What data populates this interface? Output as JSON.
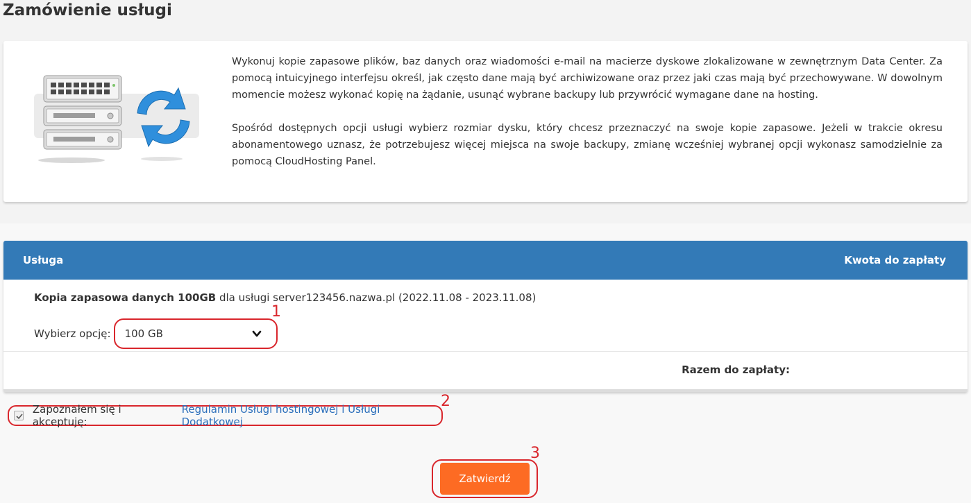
{
  "page": {
    "title": "Zamówienie usługi"
  },
  "intro": {
    "paragraph1": "Wykonuj kopie zapasowe plików, baz danych oraz wiadomości e-mail na macierze dyskowe zlokalizowane w zewnętrznym Data Center. Za pomocą intuicyjnego interfejsu określ, jak często dane mają być archiwizowane oraz przez jaki czas mają być przechowywane. W dowolnym momencie możesz wykonać kopię na żądanie, usunąć wybrane backupy lub przywrócić wymagane dane na hosting.",
    "paragraph2": "Spośród dostępnych opcji usługi wybierz rozmiar dysku, który chcesz przeznaczyć na swoje kopie zapasowe. Jeżeli w trakcie okresu abonamentowego uznasz, że potrzebujesz więcej miejsca na swoje backupy, zmianę wcześniej wybranej opcji wykonasz samodzielnie za pomocą CloudHosting Panel.",
    "illustration_icon": "server-backup-sync-icon"
  },
  "order": {
    "header_service": "Usługa",
    "header_amount": "Kwota do zapłaty",
    "service_name": "Kopia zapasowa danych 100GB",
    "service_suffix": "dla usługi server123456.nazwa.pl (2022.11.08 - 2023.11.08)",
    "option_label": "Wybierz opcję:",
    "option_selected": "100 GB",
    "total_label": "Razem do zapłaty:"
  },
  "terms": {
    "label": "Zapoznałem się i akceptuję:",
    "link_text": "Regulamin Usługi hostingowej i Usługi Dodatkowej",
    "checked": true
  },
  "submit": {
    "label": "Zatwierdź"
  },
  "annotations": [
    "1",
    "2",
    "3"
  ],
  "colors": {
    "header_blue": "#337ab7",
    "accent_orange": "#fd6b23",
    "annotation_red": "#d9262c",
    "link_blue": "#2a6ebb"
  }
}
